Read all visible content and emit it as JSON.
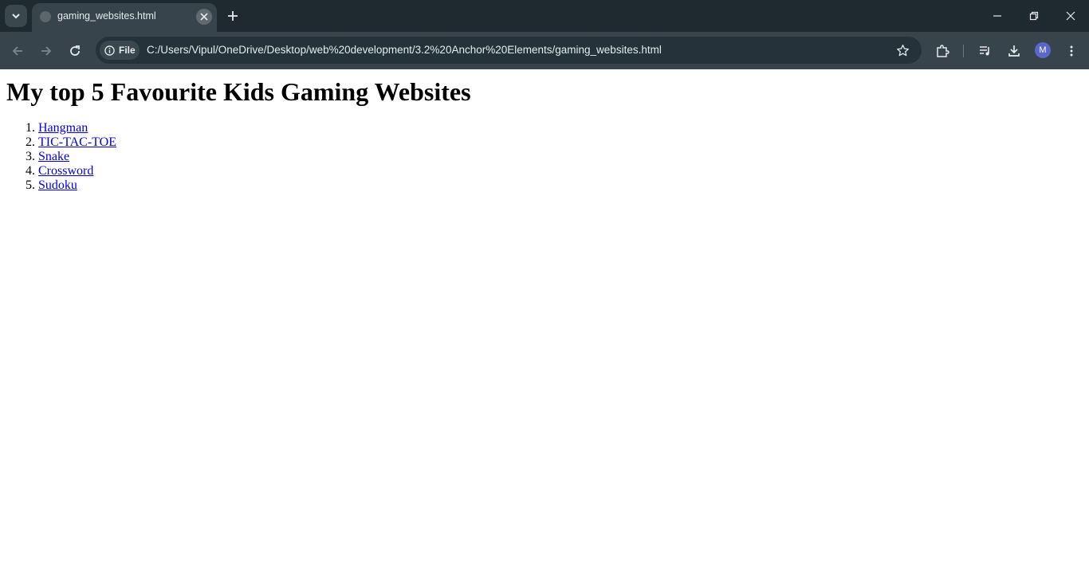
{
  "browser": {
    "tab_title": "gaming_websites.html",
    "site_chip_label": "File",
    "url": "C:/Users/Vipul/OneDrive/Desktop/web%20development/3.2%20Anchor%20Elements/gaming_websites.html",
    "profile_initial": "M"
  },
  "page": {
    "heading": "My top 5 Favourite Kids Gaming Websites",
    "links": [
      {
        "label": "Hangman"
      },
      {
        "label": "TIC-TAC-TOE"
      },
      {
        "label": "Snake"
      },
      {
        "label": "Crossword"
      },
      {
        "label": "Sudoku"
      }
    ]
  },
  "colors": {
    "titlebar": "#1f2a30",
    "toolbar": "#37444b",
    "link": "#0000ee"
  }
}
